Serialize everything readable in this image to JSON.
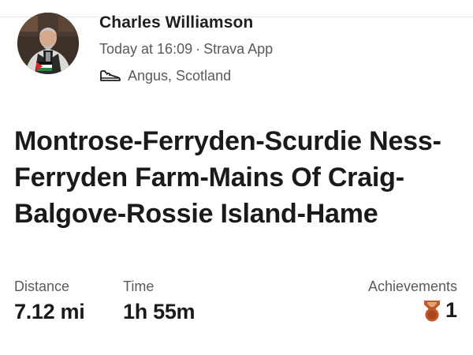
{
  "header": {
    "athlete_name": "Charles Williamson",
    "date": "Today at 16:09",
    "separator": "·",
    "source": "Strava App",
    "location": "Angus, Scotland",
    "activity_icon": "running-shoe-icon"
  },
  "activity": {
    "title": "Montrose-Ferryden-Scurdie Ness-Ferryden Farm-Mains Of Craig-Balgove-Rossie Island-Hame"
  },
  "stats": {
    "distance_label": "Distance",
    "distance_value": "7.12 mi",
    "time_label": "Time",
    "time_value": "1h 55m",
    "achievements_label": "Achievements",
    "achievements_count": "1",
    "achievements_icon": "medal-icon"
  },
  "colors": {
    "text_primary": "#1a1a1a",
    "text_secondary": "#5a5a5a",
    "medal": "#c0592b"
  }
}
